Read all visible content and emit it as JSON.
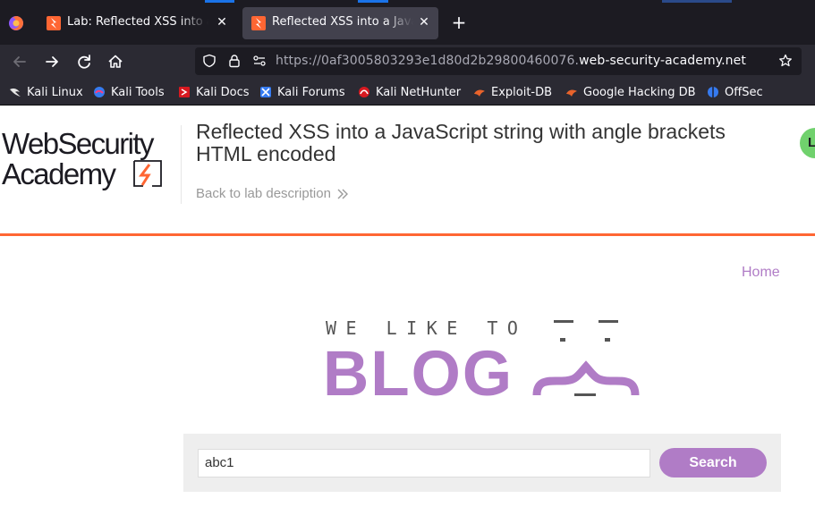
{
  "browser": {
    "tabs": [
      {
        "title": "Lab: Reflected XSS into a JavaScript string with angle brackets HTML encoded",
        "active": false
      },
      {
        "title": "Reflected XSS into a JavaScript string with angle brackets HTML encoded",
        "active": true
      }
    ],
    "url": {
      "prefix": "https://0af3005803293e1d80d2b29800460076.",
      "domain": "web-security-academy.net"
    },
    "bookmarks": [
      {
        "label": "Kali Linux",
        "icon": "kali-dragon-icon"
      },
      {
        "label": "Kali Tools",
        "icon": "kali-tools-icon"
      },
      {
        "label": "Kali Docs",
        "icon": "kali-docs-icon"
      },
      {
        "label": "Kali Forums",
        "icon": "kali-forums-icon"
      },
      {
        "label": "Kali NetHunter",
        "icon": "nethunter-icon"
      },
      {
        "label": "Exploit-DB",
        "icon": "exploit-db-icon"
      },
      {
        "label": "Google Hacking DB",
        "icon": "ghdb-icon"
      },
      {
        "label": "OffSec",
        "icon": "offsec-icon"
      }
    ],
    "colors": {
      "tabbar": "#1c1b22",
      "toolbar": "#2b2a33",
      "active_tab": "#42414d"
    }
  },
  "lab": {
    "logo_line1": "WebSecurity",
    "logo_line2": "Academy",
    "title": "Reflected XSS into a JavaScript string with angle brackets HTML encoded",
    "back_link": "Back to lab description",
    "status_initial": "L",
    "accent": "#ff6633"
  },
  "blog": {
    "nav_home": "Home",
    "tagline": "WE LIKE TO",
    "wordmark": "BLOG",
    "search_value": "abc1",
    "search_button": "Search",
    "accent": "#b07cc6"
  }
}
